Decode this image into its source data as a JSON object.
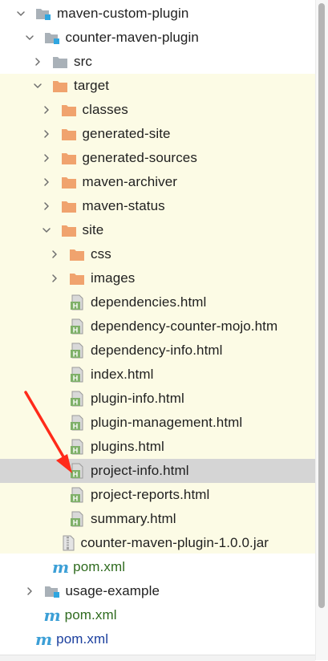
{
  "tree": [
    {
      "label": "maven-custom-plugin",
      "kind": "module",
      "depth": 0,
      "chevron": "down"
    },
    {
      "label": "counter-maven-plugin",
      "kind": "module",
      "depth": 1,
      "chevron": "down"
    },
    {
      "label": "src",
      "kind": "folder-grey",
      "depth": 2,
      "chevron": "right"
    },
    {
      "label": "target",
      "kind": "folder-orange",
      "depth": 2,
      "chevron": "down"
    },
    {
      "label": "classes",
      "kind": "folder-orange",
      "depth": 3,
      "chevron": "right"
    },
    {
      "label": "generated-site",
      "kind": "folder-orange",
      "depth": 3,
      "chevron": "right"
    },
    {
      "label": "generated-sources",
      "kind": "folder-orange",
      "depth": 3,
      "chevron": "right"
    },
    {
      "label": "maven-archiver",
      "kind": "folder-orange",
      "depth": 3,
      "chevron": "right"
    },
    {
      "label": "maven-status",
      "kind": "folder-orange",
      "depth": 3,
      "chevron": "right"
    },
    {
      "label": "site",
      "kind": "folder-orange",
      "depth": 3,
      "chevron": "down"
    },
    {
      "label": "css",
      "kind": "folder-orange",
      "depth": 4,
      "chevron": "right"
    },
    {
      "label": "images",
      "kind": "folder-orange",
      "depth": 4,
      "chevron": "right"
    },
    {
      "label": "dependencies.html",
      "kind": "html-file",
      "depth": 4,
      "chevron": "none"
    },
    {
      "label": "dependency-counter-mojo.htm",
      "kind": "html-file",
      "depth": 4,
      "chevron": "none"
    },
    {
      "label": "dependency-info.html",
      "kind": "html-file",
      "depth": 4,
      "chevron": "none"
    },
    {
      "label": "index.html",
      "kind": "html-file",
      "depth": 4,
      "chevron": "none"
    },
    {
      "label": "plugin-info.html",
      "kind": "html-file",
      "depth": 4,
      "chevron": "none"
    },
    {
      "label": "plugin-management.html",
      "kind": "html-file",
      "depth": 4,
      "chevron": "none"
    },
    {
      "label": "plugins.html",
      "kind": "html-file",
      "depth": 4,
      "chevron": "none"
    },
    {
      "label": "project-info.html",
      "kind": "html-file",
      "depth": 4,
      "chevron": "none",
      "selected": true
    },
    {
      "label": "project-reports.html",
      "kind": "html-file",
      "depth": 4,
      "chevron": "none"
    },
    {
      "label": "summary.html",
      "kind": "html-file",
      "depth": 4,
      "chevron": "none"
    },
    {
      "label": "counter-maven-plugin-1.0.0.jar",
      "kind": "jar-file",
      "depth": 3,
      "chevron": "none"
    },
    {
      "label": "pom.xml",
      "kind": "maven-pom",
      "depth": 2,
      "chevron": "none",
      "color": "green"
    },
    {
      "label": "usage-example",
      "kind": "module",
      "depth": 1,
      "chevron": "right"
    },
    {
      "label": "pom.xml",
      "kind": "maven-pom",
      "depth": 1,
      "chevron": "none",
      "color": "green"
    },
    {
      "label": "pom.xml",
      "kind": "maven-pom",
      "depth": 0,
      "chevron": "none",
      "color": "blue"
    }
  ],
  "icons": {
    "module": "module-folder-icon",
    "folder-grey": "source-folder-icon",
    "folder-orange": "excluded-folder-icon",
    "html-file": "html-file-icon",
    "jar-file": "jar-archive-icon",
    "maven-pom": "maven-icon"
  },
  "colors": {
    "folder_orange": "#f0a36e",
    "folder_grey": "#a9b1b8",
    "module_blue": "#2fa6e0",
    "html_green": "#7fb069",
    "excluded_background": "#fcfbe5",
    "selected_row": "#d5d5d5",
    "annotation_arrow": "#ff2a1a",
    "text_green": "#2f6b1f",
    "text_blue": "#1b3f9e"
  },
  "html_icon_letter": "H",
  "maven_icon_letter": "m"
}
